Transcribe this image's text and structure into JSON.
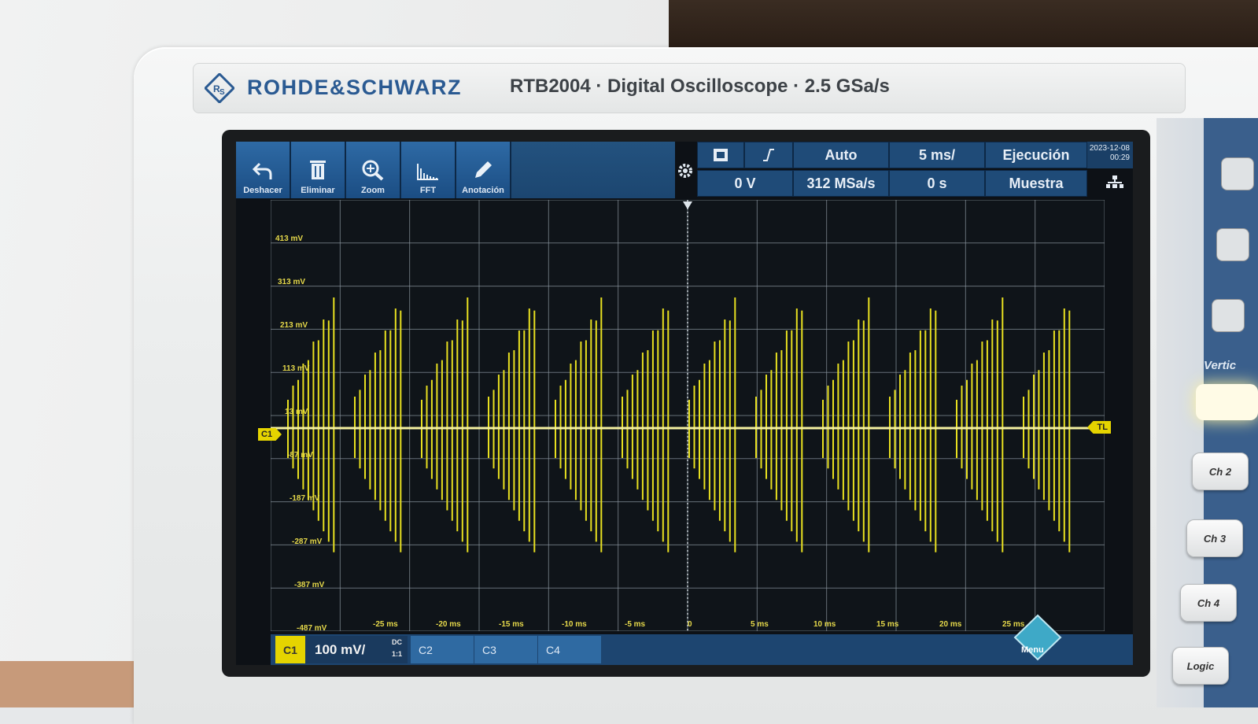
{
  "header": {
    "brand": "ROHDE&SCHWARZ",
    "model_line": "RTB2004 · Digital Oscilloscope · 2.5 GSa/s"
  },
  "toolbar": {
    "tools": [
      {
        "label": "Deshacer",
        "icon": "undo-icon"
      },
      {
        "label": "Eliminar",
        "icon": "trash-icon"
      },
      {
        "label": "Zoom",
        "icon": "zoom-icon"
      },
      {
        "label": "FFT",
        "icon": "fft-icon"
      },
      {
        "label": "Anotación",
        "icon": "pencil-icon"
      }
    ]
  },
  "status": {
    "trigger_mode": "Auto",
    "timebase": "5 ms/",
    "run_state": "Ejecución",
    "trigger_level": "0 V",
    "sample_rate": "312 MSa/s",
    "time_offset": "0 s",
    "acq_mode": "Muestra",
    "date": "2023-12-08",
    "time": "00:29"
  },
  "y_labels": [
    "413 mV",
    "313 mV",
    "213 mV",
    "113 mV",
    "13 mV",
    "-87 mV",
    "-187 mV",
    "-287 mV",
    "-387 mV",
    "-487 mV"
  ],
  "x_labels": [
    "-25 ms",
    "-20 ms",
    "-15 ms",
    "-10 ms",
    "-5 ms",
    "0",
    "5 ms",
    "10 ms",
    "15 ms",
    "20 ms",
    "25 ms"
  ],
  "markers": {
    "channel": "C1",
    "trigger_level": "TL"
  },
  "channels": {
    "c1_tag": "C1",
    "c1_scale": "100 mV/",
    "c1_coupling": "DC",
    "c1_probe": "1:1",
    "others": [
      "C2",
      "C3",
      "C4"
    ]
  },
  "menu_label": "Menu",
  "side_panel": {
    "section_label": "Vertic",
    "keys": [
      "Ch 2",
      "Ch 3",
      "Ch 4",
      "Logic"
    ]
  },
  "colors": {
    "trace": "#e8e020",
    "grid": "#8c96a0",
    "accent": "#2a5a92"
  }
}
